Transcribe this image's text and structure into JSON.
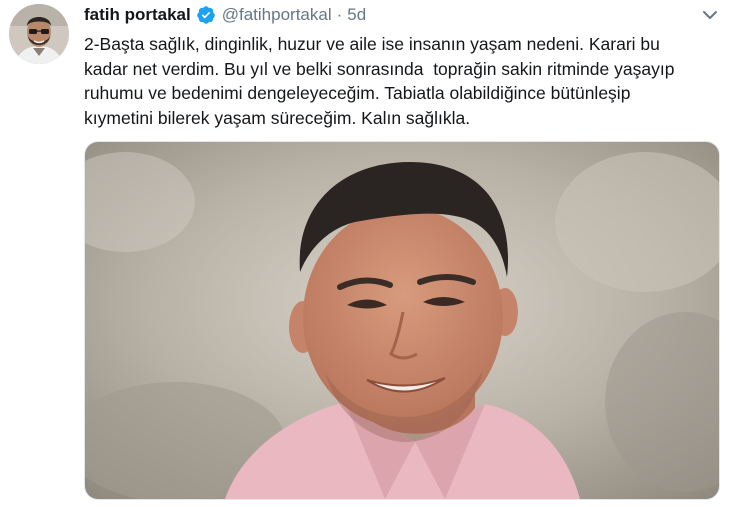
{
  "tweet": {
    "author_name": "fatih portakal",
    "handle": "@fatihportakal",
    "separator": "·",
    "timestamp": "5d",
    "text_lines": [
      "2-Başta sağlık, dinginlik, huzur ve aile ise insanın yaşam nedeni. Karari bu",
      "kadar net verdim. Bu yıl ve belki sonrasında  toprağin sakin ritminde yaşayıp",
      "ruhumu ve bedenimi dengeleyeceğim. Tabiatla olabildiğince bütünleşip",
      "kıymetini bilerek yaşam süreceğim. Kalın sağlıkla."
    ],
    "verified_badge_color": "#1da1f2",
    "verified_icon": "verified-badge-icon",
    "caret_icon": "chevron-down-icon",
    "media_description": "photo"
  }
}
